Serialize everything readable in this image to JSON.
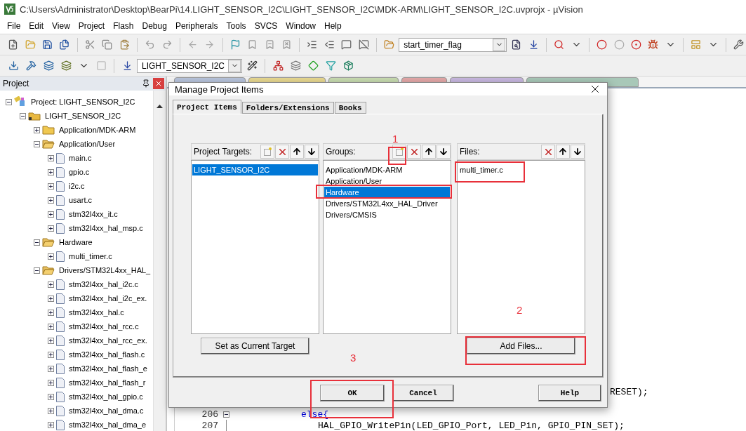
{
  "window": {
    "title": "C:\\Users\\Administrator\\Desktop\\BearPi\\14.LIGHT_SENSOR_I2C\\LIGHT_SENSOR_I2C\\MDK-ARM\\LIGHT_SENSOR_I2C.uvprojx - µVision"
  },
  "menu": [
    "File",
    "Edit",
    "View",
    "Project",
    "Flash",
    "Debug",
    "Peripherals",
    "Tools",
    "SVCS",
    "Window",
    "Help"
  ],
  "toolbar": {
    "find_combo": "start_timer_flag"
  },
  "build_toolbar": {
    "target_combo": "LIGHT_SENSOR_I2C"
  },
  "project_panel": {
    "title": "Project",
    "tree": [
      {
        "label": "Project: LIGHT_SENSOR_I2C",
        "kind": "project",
        "expanded": true,
        "children": [
          {
            "label": "LIGHT_SENSOR_I2C",
            "kind": "target",
            "expanded": true,
            "children": [
              {
                "label": "Application/MDK-ARM",
                "kind": "group",
                "expanded": false
              },
              {
                "label": "Application/User",
                "kind": "group",
                "expanded": true,
                "children": [
                  {
                    "label": "main.c",
                    "kind": "file",
                    "expanded": false
                  },
                  {
                    "label": "gpio.c",
                    "kind": "file",
                    "expanded": false
                  },
                  {
                    "label": "i2c.c",
                    "kind": "file",
                    "expanded": false
                  },
                  {
                    "label": "usart.c",
                    "kind": "file",
                    "expanded": false
                  },
                  {
                    "label": "stm32l4xx_it.c",
                    "kind": "file",
                    "expanded": false
                  },
                  {
                    "label": "stm32l4xx_hal_msp.c",
                    "kind": "file",
                    "expanded": false
                  }
                ]
              },
              {
                "label": "Hardware",
                "kind": "group",
                "expanded": true,
                "children": [
                  {
                    "label": "multi_timer.c",
                    "kind": "file",
                    "expanded": false
                  }
                ]
              },
              {
                "label": "Drivers/STM32L4xx_HAL_",
                "kind": "group",
                "expanded": true,
                "children": [
                  {
                    "label": "stm32l4xx_hal_i2c.c",
                    "kind": "file",
                    "expanded": false
                  },
                  {
                    "label": "stm32l4xx_hal_i2c_ex.",
                    "kind": "file",
                    "expanded": false
                  },
                  {
                    "label": "stm32l4xx_hal.c",
                    "kind": "file",
                    "expanded": false
                  },
                  {
                    "label": "stm32l4xx_hal_rcc.c",
                    "kind": "file",
                    "expanded": false
                  },
                  {
                    "label": "stm32l4xx_hal_rcc_ex.",
                    "kind": "file",
                    "expanded": false
                  },
                  {
                    "label": "stm32l4xx_hal_flash.c",
                    "kind": "file",
                    "expanded": false
                  },
                  {
                    "label": "stm32l4xx_hal_flash_e",
                    "kind": "file",
                    "expanded": false
                  },
                  {
                    "label": "stm32l4xx_hal_flash_r",
                    "kind": "file",
                    "expanded": false
                  },
                  {
                    "label": "stm32l4xx_hal_gpio.c",
                    "kind": "file",
                    "expanded": false
                  },
                  {
                    "label": "stm32l4xx_hal_dma.c",
                    "kind": "file",
                    "expanded": false
                  },
                  {
                    "label": "stm32l4xx_hal_dma_e",
                    "kind": "file",
                    "expanded": false
                  }
                ]
              }
            ]
          }
        ]
      }
    ]
  },
  "editor": {
    "tabs": [
      {
        "color": "#b8c4dc"
      },
      {
        "color": "#e8d890"
      },
      {
        "color": "#c8dcb0"
      },
      {
        "color": "#e4a8a8"
      },
      {
        "color": "#c8b8e0"
      },
      {
        "color": "#a8c8b8"
      }
    ],
    "lines": [
      {
        "kind": "cut",
        "text": "RESET);"
      },
      {
        "kind": "full",
        "number": "206",
        "fold": true,
        "keyword": true,
        "text": "else{"
      },
      {
        "kind": "full",
        "number": "207",
        "fold": false,
        "keyword": false,
        "text": "HAL_GPIO_WritePin(LED_GPIO_Port, LED_Pin, GPIO_PIN_SET);"
      }
    ]
  },
  "dialog": {
    "title": "Manage Project Items",
    "tabs": [
      {
        "label": "Project Items",
        "selected": true
      },
      {
        "label": "Folders/Extensions",
        "selected": false
      },
      {
        "label": "Books",
        "selected": false
      }
    ],
    "columns": [
      {
        "title": "Project Targets:",
        "can_add": true,
        "items": [
          {
            "label": "LIGHT_SENSOR_I2C",
            "selected": true
          }
        ],
        "button": "Set as Current Target"
      },
      {
        "title": "Groups:",
        "can_add": true,
        "items": [
          {
            "label": "Application/MDK-ARM",
            "selected": false
          },
          {
            "label": "Application/User",
            "selected": false
          },
          {
            "label": "Hardware",
            "selected": true
          },
          {
            "label": "Drivers/STM32L4xx_HAL_Driver",
            "selected": false
          },
          {
            "label": "Drivers/CMSIS",
            "selected": false
          }
        ]
      },
      {
        "title": "Files:",
        "can_add": false,
        "items": [
          {
            "label": "multi_timer.c",
            "selected": false
          }
        ],
        "button": "Add Files..."
      }
    ],
    "buttons": [
      "OK",
      "Cancel",
      "Help"
    ],
    "markers": [
      "1",
      "2",
      "3"
    ]
  }
}
